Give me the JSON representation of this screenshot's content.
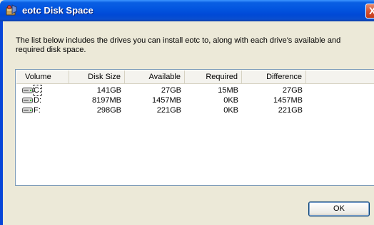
{
  "window": {
    "title": "eotc Disk Space",
    "description": "The list below includes the drives you can install eotc to, along with each drive's available and required disk space."
  },
  "table": {
    "columns": [
      "Volume",
      "Disk Size",
      "Available",
      "Required",
      "Difference"
    ],
    "rows": [
      {
        "volume": "C:",
        "disk_size": "141GB",
        "available": "27GB",
        "required": "15MB",
        "difference": "27GB"
      },
      {
        "volume": "D:",
        "disk_size": "8197MB",
        "available": "1457MB",
        "required": "0KB",
        "difference": "1457MB"
      },
      {
        "volume": "F:",
        "disk_size": "298GB",
        "available": "221GB",
        "required": "0KB",
        "difference": "221GB"
      }
    ]
  },
  "buttons": {
    "ok_label": "OK",
    "close_glyph": "X"
  },
  "icons": {
    "app": "installer-box-icon",
    "drive": "hard-drive-icon",
    "close": "close-icon"
  },
  "colors": {
    "titlebar": "#0356e0",
    "dialog_bg": "#ece9d8",
    "list_border": "#7f9db9"
  }
}
